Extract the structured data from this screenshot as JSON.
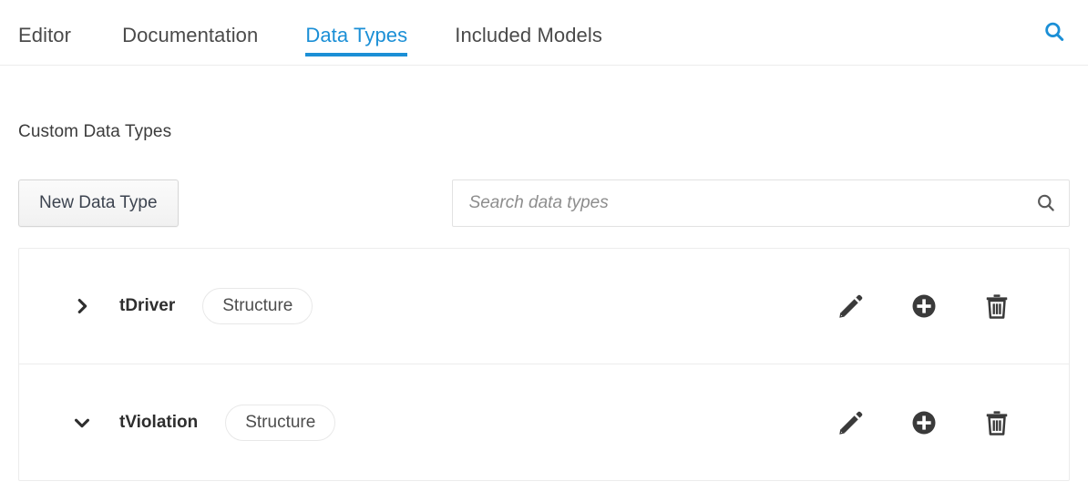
{
  "tabbar": {
    "tabs": [
      {
        "label": "Editor",
        "active": false
      },
      {
        "label": "Documentation",
        "active": false
      },
      {
        "label": "Data Types",
        "active": true
      },
      {
        "label": "Included Models",
        "active": false
      }
    ],
    "search_icon": "search-icon",
    "active_color": "#1b8fd6",
    "inactive_color": "#4a4a4a"
  },
  "main": {
    "title": "Custom Data Types",
    "new_button_label": "New Data Type",
    "search": {
      "value": "",
      "placeholder": "Search data types",
      "icon": "search-icon"
    },
    "rows": [
      {
        "name": "tDriver",
        "kind": "Structure",
        "expanded": false,
        "chevron": "chevron-right-icon",
        "actions": [
          "pencil-icon",
          "plus-circle-icon",
          "trash-icon"
        ]
      },
      {
        "name": "tViolation",
        "kind": "Structure",
        "expanded": true,
        "chevron": "chevron-down-icon",
        "actions": [
          "pencil-icon",
          "plus-circle-icon",
          "trash-icon"
        ]
      }
    ]
  }
}
